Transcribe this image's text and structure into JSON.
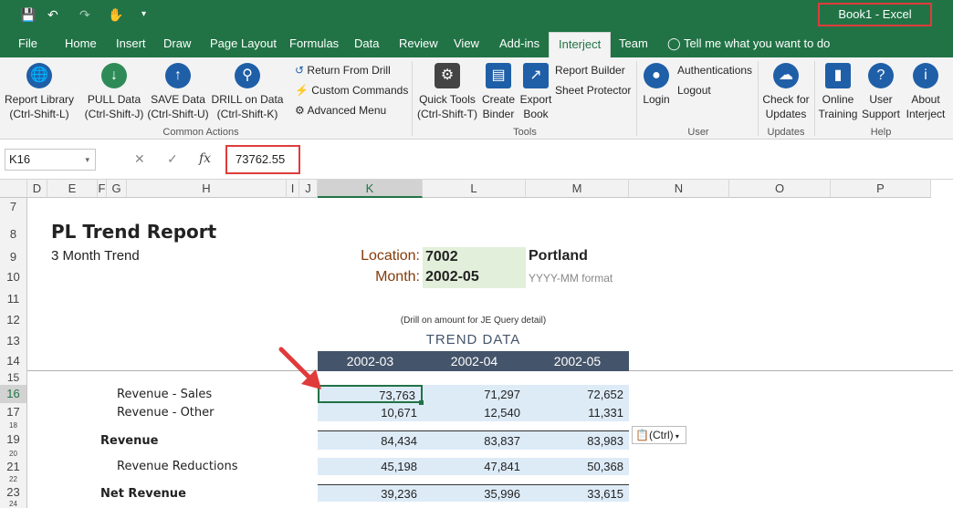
{
  "window": {
    "title": "Book1  -  Excel"
  },
  "tabs": [
    "File",
    "Home",
    "Insert",
    "Draw",
    "Page Layout",
    "Formulas",
    "Data",
    "Review",
    "View",
    "Add-ins",
    "Interject",
    "Team"
  ],
  "tell_me": "Tell me what you want to do",
  "ribbon": {
    "report_library": "Report Library",
    "report_library_key": "(Ctrl-Shift-L)",
    "pull": "PULL Data",
    "pull_key": "(Ctrl-Shift-J)",
    "save": "SAVE Data",
    "save_key": "(Ctrl-Shift-U)",
    "drill": "DRILL on Data",
    "drill_key": "(Ctrl-Shift-K)",
    "return_drill": "Return From Drill",
    "custom_cmds": "Custom Commands",
    "advanced": "Advanced Menu",
    "common_actions": "Common Actions",
    "quick_tools": "Quick Tools",
    "quick_tools_key": "(Ctrl-Shift-T)",
    "create": "Create",
    "binder": "Binder",
    "export": "Export",
    "book": "Book",
    "report_builder": "Report Builder",
    "sheet_protector": "Sheet Protector",
    "tools": "Tools",
    "login": "Login",
    "authentications": "Authentications",
    "logout": "Logout",
    "user": "User",
    "check_for": "Check for",
    "updates_btn": "Updates",
    "updates_grp": "Updates",
    "online": "Online",
    "training": "Training",
    "user_label": "User",
    "support": "Support",
    "about": "About",
    "interject": "Interject",
    "help": "Help"
  },
  "formula_bar": {
    "cell_ref": "K16",
    "value": "73762.55"
  },
  "columns": [
    "D",
    "E",
    "F",
    "G",
    "H",
    "I",
    "J",
    "K",
    "L",
    "M",
    "N",
    "O",
    "P"
  ],
  "rows": [
    "7",
    "8",
    "9",
    "10",
    "11",
    "12",
    "13",
    "14",
    "15",
    "16",
    "17",
    "18",
    "19",
    "20",
    "21",
    "22",
    "23",
    "24"
  ],
  "report": {
    "title": "PL Trend Report",
    "subtitle": "3 Month Trend",
    "location_label": "Location:",
    "location_value": "7002",
    "location_name": "Portland",
    "month_label": "Month:",
    "month_value": "2002-05",
    "month_hint": "YYYY-MM format",
    "drill_hint": "(Drill on amount for JE Query detail)",
    "trend_title": "TREND DATA",
    "periods": [
      "2002-03",
      "2002-04",
      "2002-05"
    ],
    "lines": [
      {
        "label": "Revenue - Sales",
        "values": [
          "73,763",
          "71,297",
          "72,652"
        ]
      },
      {
        "label": "Revenue - Other",
        "values": [
          "10,671",
          "12,540",
          "11,331"
        ]
      },
      {
        "label": "Revenue",
        "values": [
          "84,434",
          "83,837",
          "83,983"
        ]
      },
      {
        "label": "Revenue Reductions",
        "values": [
          "45,198",
          "47,841",
          "50,368"
        ]
      },
      {
        "label": "Net Revenue",
        "values": [
          "39,236",
          "35,996",
          "33,615"
        ]
      }
    ]
  },
  "paste_options": "(Ctrl)",
  "colors": {
    "excel_green": "#217346",
    "highlight_red": "#e03b3b",
    "header_navy": "#44546a",
    "band_blue": "#ddebf7",
    "input_green": "#e2efda"
  }
}
